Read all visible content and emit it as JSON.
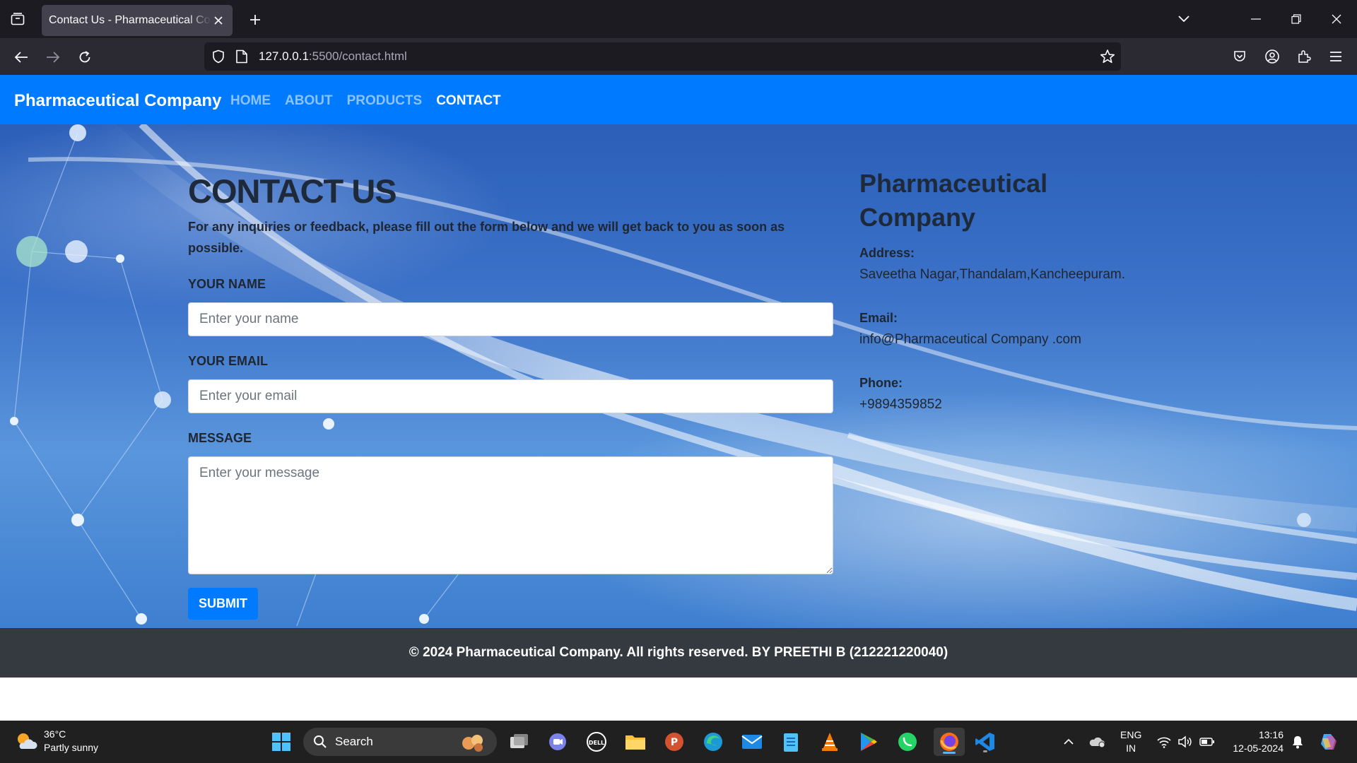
{
  "browser": {
    "tab_title": "Contact Us - Pharmaceutical Company",
    "url_host": "127.0.0.1",
    "url_rest": ":5500/contact.html"
  },
  "site": {
    "brand": "Pharmaceutical Company",
    "nav": [
      {
        "label": "HOME",
        "active": false
      },
      {
        "label": "ABOUT",
        "active": false
      },
      {
        "label": "PRODUCTS",
        "active": false
      },
      {
        "label": "CONTACT",
        "active": true
      }
    ]
  },
  "contact": {
    "title": "CONTACT US",
    "intro": "For any inquiries or feedback, please fill out the form below and we will get back to you as soon as possible.",
    "name_label": "YOUR NAME",
    "name_placeholder": "Enter your name",
    "email_label": "YOUR EMAIL",
    "email_placeholder": "Enter your email",
    "message_label": "MESSAGE",
    "message_placeholder": "Enter your message",
    "submit_label": "SUBMIT"
  },
  "info": {
    "title": "Pharmaceutical Company",
    "address_label": "Address:",
    "address_value": "Saveetha Nagar,Thandalam,Kancheepuram.",
    "email_label": "Email:",
    "email_value": "info@Pharmaceutical Company .com",
    "phone_label": "Phone:",
    "phone_value": "+9894359852"
  },
  "footer": {
    "text": "© 2024 Pharmaceutical Company. All rights reserved. BY PREETHI B (212221220040)"
  },
  "taskbar": {
    "weather_temp": "36°C",
    "weather_desc": "Partly sunny",
    "search_label": "Search",
    "lang_line1": "ENG",
    "lang_line2": "IN",
    "time": "13:16",
    "date": "12-05-2024"
  },
  "colors": {
    "site_nav": "#007bff",
    "footer": "#343a40",
    "browser_bg": "#1c1b22"
  }
}
